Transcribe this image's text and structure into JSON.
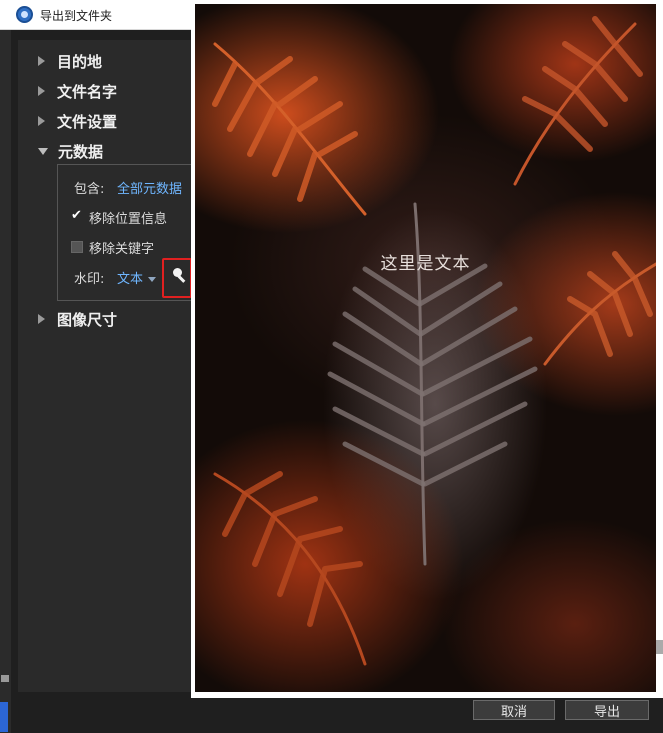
{
  "window": {
    "title": "导出到文件夹"
  },
  "sections": [
    {
      "label": "目的地",
      "expanded": false
    },
    {
      "label": "文件名字",
      "expanded": false
    },
    {
      "label": "文件设置",
      "expanded": false
    },
    {
      "label": "元数据",
      "expanded": true
    },
    {
      "label": "图像尺寸",
      "expanded": false
    }
  ],
  "metadata": {
    "include_label": "包含:",
    "include_value": "全部元数据",
    "remove_location_label": "移除位置信息",
    "remove_location_checked": true,
    "remove_keywords_label": "移除关键字",
    "remove_keywords_checked": false,
    "watermark_label": "水印:",
    "watermark_value": "文本"
  },
  "preview": {
    "watermark_text": "这里是文本"
  },
  "buttons": {
    "cancel": "取消",
    "export": "导出"
  },
  "colors": {
    "link": "#6fb6ff",
    "highlight": "#e02020",
    "panel": "#2a2a2a"
  },
  "icons": {
    "search": "search-icon",
    "app": "app-icon"
  }
}
